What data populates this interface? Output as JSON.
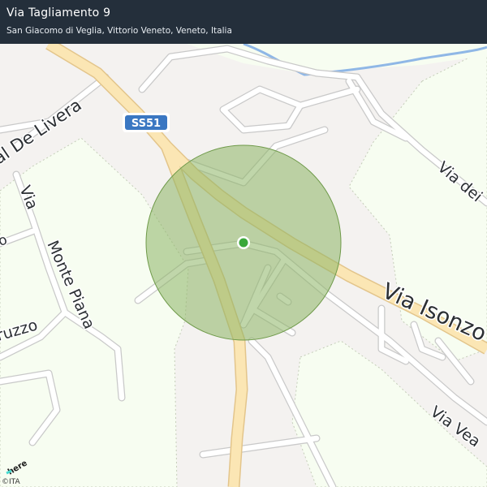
{
  "header": {
    "title": "Via Tagliamento 9",
    "subtitle": "San Giacomo di Veglia, Vittorio Veneto, Veneto, Italia"
  },
  "map": {
    "route_shield": "SS51",
    "streets": [
      "al De Livera",
      "Via",
      "Monte Piana",
      "ruzzo",
      "o",
      "Via dei",
      "Via Isonzo",
      "Via Vea"
    ],
    "accuracy_circle_color": "#8cb464",
    "location_dot_color": "#3aa83a",
    "colors": {
      "background": "#f4f2f0",
      "park": "#f7fdf1",
      "major_road": "#fbe6b4",
      "major_road_casing": "#e3c58b",
      "minor_road": "#ffffff",
      "minor_road_casing": "#c9c9c9",
      "river": "#8fb7e6",
      "shield": "#3a77c2"
    }
  },
  "branding": {
    "logo_text": "here",
    "attribution": "©ITA"
  }
}
